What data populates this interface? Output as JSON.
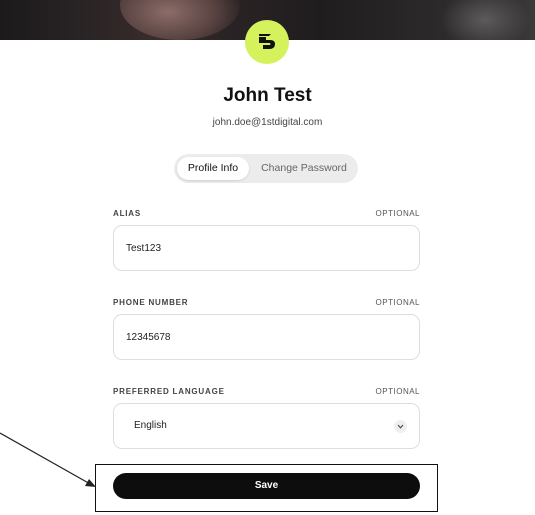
{
  "profile": {
    "name": "John Test",
    "email": "john.doe@1stdigital.com"
  },
  "tabs": [
    {
      "label": "Profile Info",
      "active": true
    },
    {
      "label": "Change Password",
      "active": false
    }
  ],
  "form": {
    "alias": {
      "label": "ALIAS",
      "optional": "OPTIONAL",
      "value": "Test123"
    },
    "phone": {
      "label": "PHONE NUMBER",
      "optional": "OPTIONAL",
      "value": "12345678"
    },
    "language": {
      "label": "PREFERRED LANGUAGE",
      "optional": "OPTIONAL",
      "value": "English"
    }
  },
  "actions": {
    "save_label": "Save"
  },
  "colors": {
    "logo_bg": "#d5f25c",
    "button_bg": "#0d0d0d",
    "banner": "#2a2526"
  },
  "icons": {
    "logo": "brand-logo-icon",
    "chevron": "chevron-down-icon",
    "annotation": "arrow-annotation"
  }
}
